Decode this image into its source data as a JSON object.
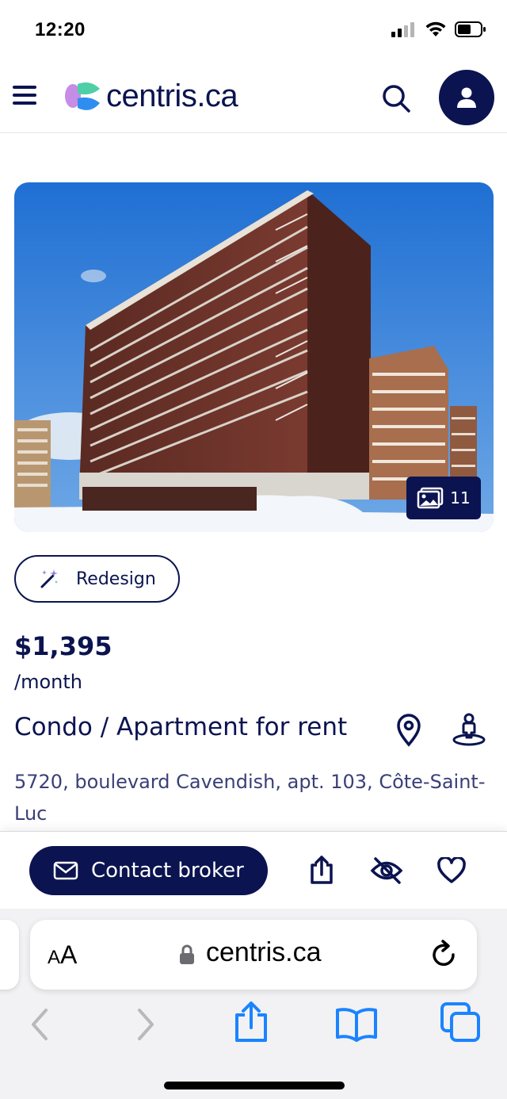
{
  "status_bar": {
    "time": "12:20",
    "icons": [
      "signal-icon",
      "wifi-icon",
      "battery-icon"
    ]
  },
  "header": {
    "logo_text": "centris.ca",
    "icons": [
      "menu-icon",
      "search-icon",
      "account-icon"
    ]
  },
  "listing": {
    "photo_count": "11",
    "redesign_label": "Redesign",
    "price": "$1,395",
    "price_unit": "/month",
    "title": "Condo / Apartment for rent",
    "address": "5720, boulevard Cavendish, apt. 103, Côte-Saint-Luc"
  },
  "action_bar": {
    "contact_label": "Contact broker",
    "icons": [
      "share-icon",
      "hide-icon",
      "heart-icon"
    ]
  },
  "browser": {
    "text_size_small": "A",
    "text_size_big": "A",
    "url": "centris.ca",
    "toolbar_icons": [
      "back-icon",
      "forward-icon",
      "share-icon",
      "bookmarks-icon",
      "tabs-icon"
    ]
  },
  "colors": {
    "brand_navy": "#0b1450",
    "ios_blue": "#1a84ff",
    "logo_purple": "#c58de6",
    "logo_teal": "#4ecfa7",
    "logo_blue": "#2f8df0"
  }
}
